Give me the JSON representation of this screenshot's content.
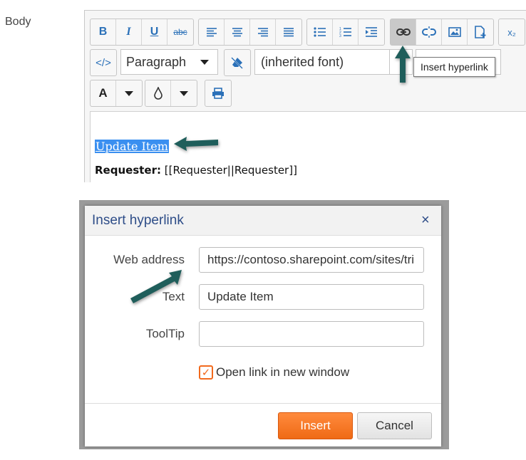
{
  "top": {
    "body_label": "Body",
    "format_select": "Paragraph",
    "font_select": "(inherited font)",
    "tooltip": "Insert hyperlink",
    "link_text": "Update Item",
    "requester_label": "Requester:",
    "requester_value": "[[Requester||Requester]]",
    "toolbar": {
      "bold": "B",
      "italic": "I",
      "underline": "U",
      "strike": "abc",
      "text_color": "A",
      "subscript": "x₂"
    }
  },
  "dialog": {
    "title": "Insert hyperlink",
    "close": "×",
    "web_address_label": "Web address",
    "web_address_value": "https://contoso.sharepoint.com/sites/tri",
    "text_label": "Text",
    "text_value": "Update Item",
    "tooltip_label": "ToolTip",
    "tooltip_value": "",
    "open_new_window_label": "Open link in new window",
    "open_new_window_checked": true,
    "insert_label": "Insert",
    "cancel_label": "Cancel"
  },
  "colors": {
    "accent_orange": "#ef6a15",
    "annotation_arrow": "#1f5e5b",
    "title_blue": "#2e4d88",
    "toolbar_icon_blue": "#2a70b8"
  }
}
